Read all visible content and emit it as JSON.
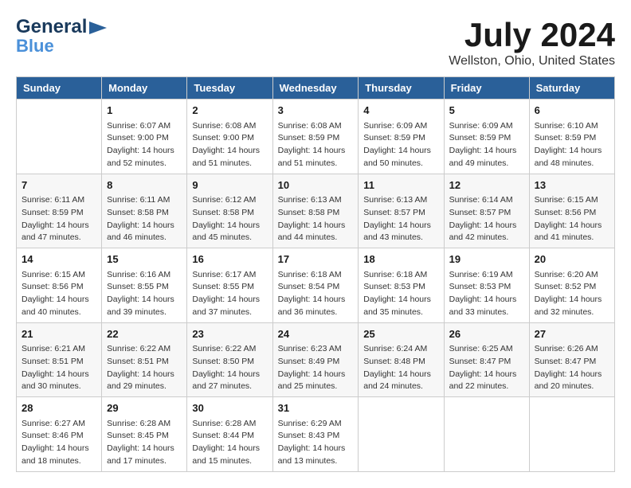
{
  "header": {
    "logo_general": "General",
    "logo_blue": "Blue",
    "month_title": "July 2024",
    "location": "Wellston, Ohio, United States"
  },
  "calendar": {
    "days_of_week": [
      "Sunday",
      "Monday",
      "Tuesday",
      "Wednesday",
      "Thursday",
      "Friday",
      "Saturday"
    ],
    "weeks": [
      [
        {
          "day": "",
          "info": ""
        },
        {
          "day": "1",
          "info": "Sunrise: 6:07 AM\nSunset: 9:00 PM\nDaylight: 14 hours\nand 52 minutes."
        },
        {
          "day": "2",
          "info": "Sunrise: 6:08 AM\nSunset: 9:00 PM\nDaylight: 14 hours\nand 51 minutes."
        },
        {
          "day": "3",
          "info": "Sunrise: 6:08 AM\nSunset: 8:59 PM\nDaylight: 14 hours\nand 51 minutes."
        },
        {
          "day": "4",
          "info": "Sunrise: 6:09 AM\nSunset: 8:59 PM\nDaylight: 14 hours\nand 50 minutes."
        },
        {
          "day": "5",
          "info": "Sunrise: 6:09 AM\nSunset: 8:59 PM\nDaylight: 14 hours\nand 49 minutes."
        },
        {
          "day": "6",
          "info": "Sunrise: 6:10 AM\nSunset: 8:59 PM\nDaylight: 14 hours\nand 48 minutes."
        }
      ],
      [
        {
          "day": "7",
          "info": "Sunrise: 6:11 AM\nSunset: 8:59 PM\nDaylight: 14 hours\nand 47 minutes."
        },
        {
          "day": "8",
          "info": "Sunrise: 6:11 AM\nSunset: 8:58 PM\nDaylight: 14 hours\nand 46 minutes."
        },
        {
          "day": "9",
          "info": "Sunrise: 6:12 AM\nSunset: 8:58 PM\nDaylight: 14 hours\nand 45 minutes."
        },
        {
          "day": "10",
          "info": "Sunrise: 6:13 AM\nSunset: 8:58 PM\nDaylight: 14 hours\nand 44 minutes."
        },
        {
          "day": "11",
          "info": "Sunrise: 6:13 AM\nSunset: 8:57 PM\nDaylight: 14 hours\nand 43 minutes."
        },
        {
          "day": "12",
          "info": "Sunrise: 6:14 AM\nSunset: 8:57 PM\nDaylight: 14 hours\nand 42 minutes."
        },
        {
          "day": "13",
          "info": "Sunrise: 6:15 AM\nSunset: 8:56 PM\nDaylight: 14 hours\nand 41 minutes."
        }
      ],
      [
        {
          "day": "14",
          "info": "Sunrise: 6:15 AM\nSunset: 8:56 PM\nDaylight: 14 hours\nand 40 minutes."
        },
        {
          "day": "15",
          "info": "Sunrise: 6:16 AM\nSunset: 8:55 PM\nDaylight: 14 hours\nand 39 minutes."
        },
        {
          "day": "16",
          "info": "Sunrise: 6:17 AM\nSunset: 8:55 PM\nDaylight: 14 hours\nand 37 minutes."
        },
        {
          "day": "17",
          "info": "Sunrise: 6:18 AM\nSunset: 8:54 PM\nDaylight: 14 hours\nand 36 minutes."
        },
        {
          "day": "18",
          "info": "Sunrise: 6:18 AM\nSunset: 8:53 PM\nDaylight: 14 hours\nand 35 minutes."
        },
        {
          "day": "19",
          "info": "Sunrise: 6:19 AM\nSunset: 8:53 PM\nDaylight: 14 hours\nand 33 minutes."
        },
        {
          "day": "20",
          "info": "Sunrise: 6:20 AM\nSunset: 8:52 PM\nDaylight: 14 hours\nand 32 minutes."
        }
      ],
      [
        {
          "day": "21",
          "info": "Sunrise: 6:21 AM\nSunset: 8:51 PM\nDaylight: 14 hours\nand 30 minutes."
        },
        {
          "day": "22",
          "info": "Sunrise: 6:22 AM\nSunset: 8:51 PM\nDaylight: 14 hours\nand 29 minutes."
        },
        {
          "day": "23",
          "info": "Sunrise: 6:22 AM\nSunset: 8:50 PM\nDaylight: 14 hours\nand 27 minutes."
        },
        {
          "day": "24",
          "info": "Sunrise: 6:23 AM\nSunset: 8:49 PM\nDaylight: 14 hours\nand 25 minutes."
        },
        {
          "day": "25",
          "info": "Sunrise: 6:24 AM\nSunset: 8:48 PM\nDaylight: 14 hours\nand 24 minutes."
        },
        {
          "day": "26",
          "info": "Sunrise: 6:25 AM\nSunset: 8:47 PM\nDaylight: 14 hours\nand 22 minutes."
        },
        {
          "day": "27",
          "info": "Sunrise: 6:26 AM\nSunset: 8:47 PM\nDaylight: 14 hours\nand 20 minutes."
        }
      ],
      [
        {
          "day": "28",
          "info": "Sunrise: 6:27 AM\nSunset: 8:46 PM\nDaylight: 14 hours\nand 18 minutes."
        },
        {
          "day": "29",
          "info": "Sunrise: 6:28 AM\nSunset: 8:45 PM\nDaylight: 14 hours\nand 17 minutes."
        },
        {
          "day": "30",
          "info": "Sunrise: 6:28 AM\nSunset: 8:44 PM\nDaylight: 14 hours\nand 15 minutes."
        },
        {
          "day": "31",
          "info": "Sunrise: 6:29 AM\nSunset: 8:43 PM\nDaylight: 14 hours\nand 13 minutes."
        },
        {
          "day": "",
          "info": ""
        },
        {
          "day": "",
          "info": ""
        },
        {
          "day": "",
          "info": ""
        }
      ]
    ]
  }
}
